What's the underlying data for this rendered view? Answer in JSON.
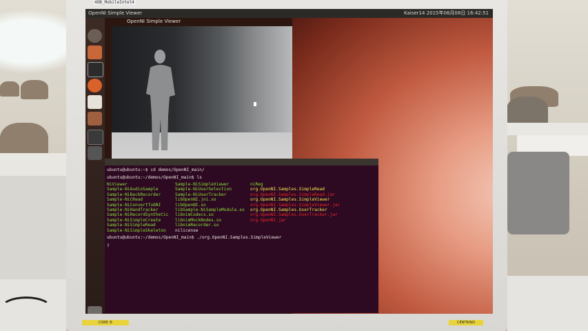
{
  "top_label": "4OB_MobileIntel4",
  "desktop": {
    "panel_title": "OpenNI Simple Viewer",
    "panel_right": "Kaiser14 2015年06月08日 16:42:51"
  },
  "depth_window": {
    "title": "OpenNI Simple Viewer"
  },
  "terminal": {
    "prompt_lines": [
      "ubuntu@ubuntu:~$ cd demos/OpenNI_main/",
      "ubuntu@ubuntu:~/demos/OpenNI_main$ ls"
    ],
    "col1": [
      "NiViewer",
      "Sample-NiAudioSample",
      "Sample-NiBackRecorder",
      "Sample-NiCRead",
      "Sample-NiConvertToONI",
      "Sample-NiHandTracker",
      "Sample-NiRecordSynthetic",
      "Sample-NiSimpleCreate",
      "Sample-NiSimpleRead",
      "Sample-NiSimpleSkeleton"
    ],
    "col2": [
      "Sample-NiSimpleViewer",
      "Sample-NiUserSelection",
      "Sample-NiUserTracker",
      "libOpenNI.jni.so",
      "libOpenNI.so",
      "libSample-NiSampleModule.so",
      "libnimCodecs.so",
      "libnimMockNodes.so",
      "libnimRecorder.so",
      "nilicense"
    ],
    "col3": [
      "niReg",
      "org.OpenNI.Samples.SimpleRead",
      "org.OpenNI.Samples.SimpleRead.jar",
      "org.OpenNI.Samples.SimpleViewer",
      "org.OpenNI.Samples.SimpleViewer.jar",
      "org.OpenNI.Samples.UserTracker",
      "org.OpenNI.Samples.UserTracker.jar",
      "org.OpenNI.jar",
      "",
      ""
    ],
    "col3_colors": [
      "g",
      "y",
      "r",
      "y",
      "r",
      "y",
      "r",
      "r",
      "",
      ""
    ],
    "last_command": "ubuntu@ubuntu:~/demos/OpenNI_main$ ./org.OpenNI.Samples.SimpleViewer"
  },
  "stickers": {
    "left": "CORE i5",
    "right": "CENTRINO"
  }
}
